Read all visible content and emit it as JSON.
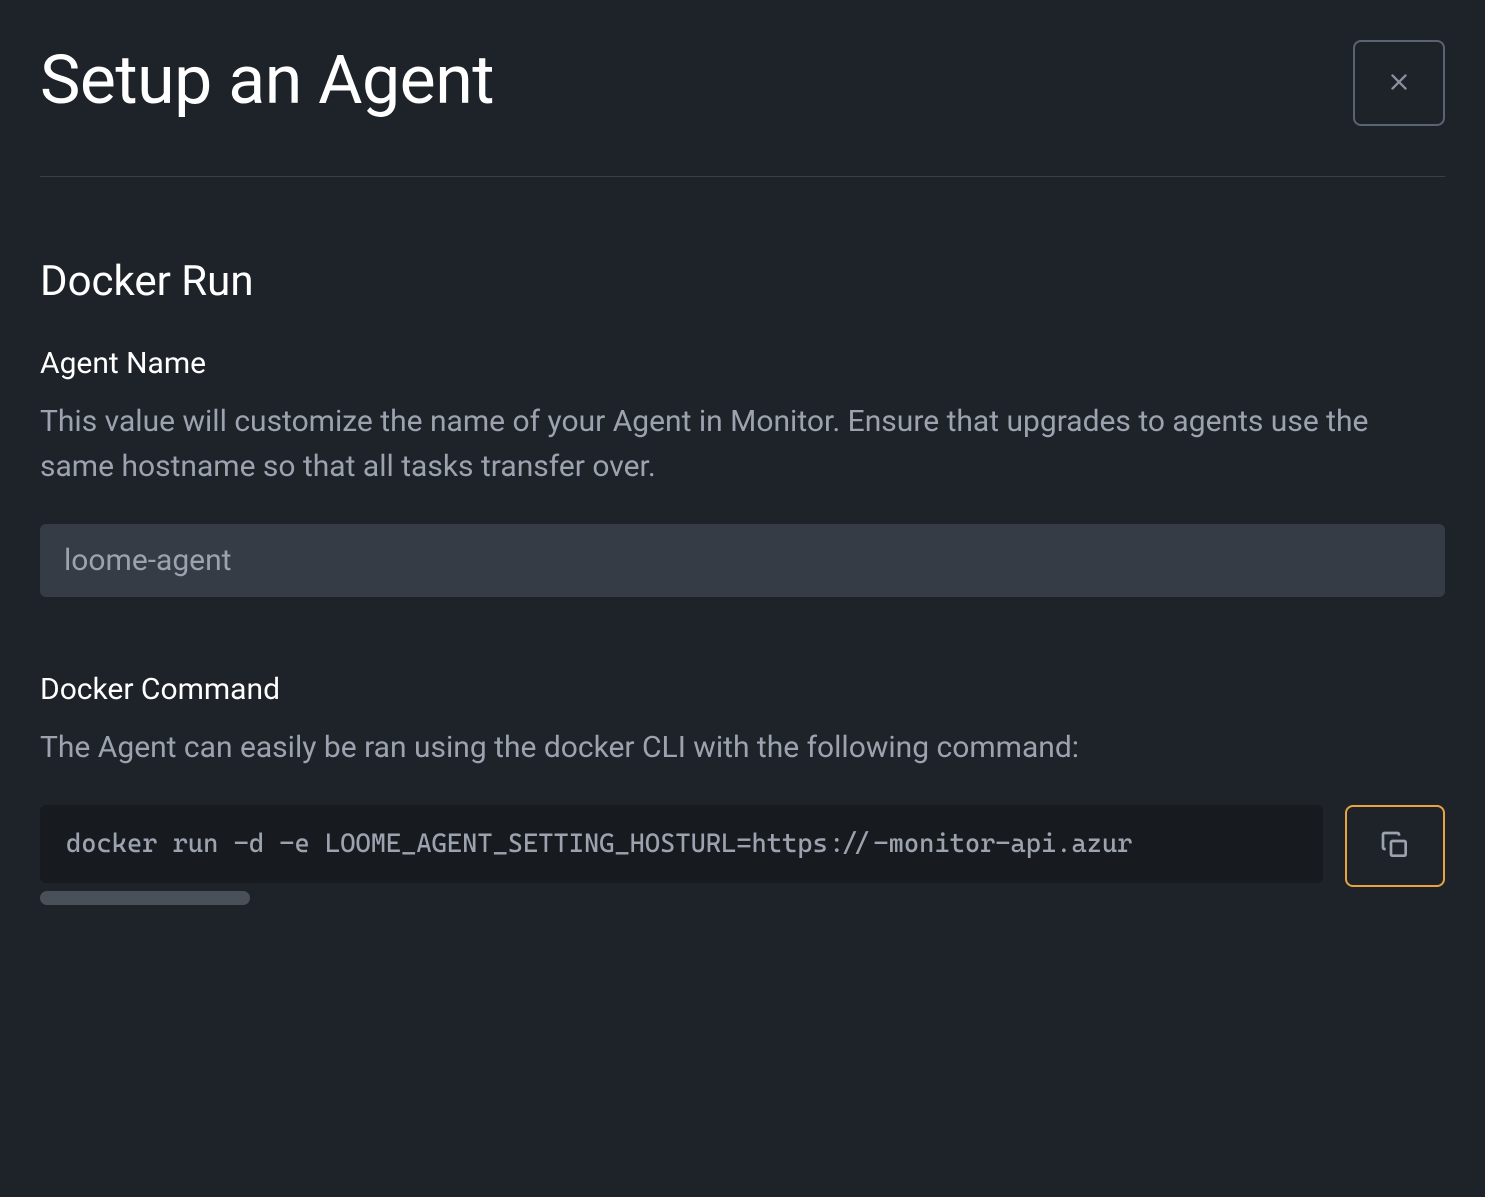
{
  "header": {
    "title": "Setup an Agent"
  },
  "section": {
    "title": "Docker Run"
  },
  "agentName": {
    "label": "Agent Name",
    "description": "This value will customize the name of your Agent in Monitor. Ensure that upgrades to agents use the same hostname so that all tasks transfer over.",
    "placeholder": "loome-agent",
    "value": ""
  },
  "dockerCommand": {
    "label": "Docker Command",
    "description": "The Agent can easily be ran using the docker CLI with the following command:",
    "command": "docker run -d -e LOOME_AGENT_SETTING_HOSTURL=https://-monitor-api.azur"
  },
  "colors": {
    "accent": "#e8a43f"
  }
}
